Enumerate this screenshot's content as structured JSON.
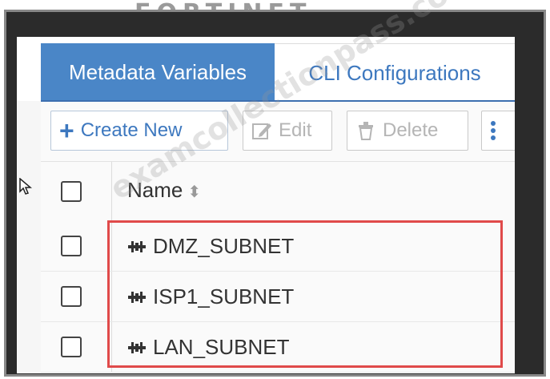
{
  "brand": {
    "logo_text": "FORTINET"
  },
  "tabs": [
    {
      "label": "Metadata Variables",
      "active": true
    },
    {
      "label": "CLI Configurations",
      "active": false
    }
  ],
  "toolbar": {
    "create_label": "Create New",
    "edit_label": "Edit",
    "delete_label": "Delete"
  },
  "table": {
    "header_name": "Name",
    "rows": [
      {
        "name": "DMZ_SUBNET",
        "icon": "network-object-icon"
      },
      {
        "name": "ISP1_SUBNET",
        "icon": "network-object-icon"
      },
      {
        "name": "LAN_SUBNET",
        "icon": "network-object-icon"
      }
    ]
  },
  "watermark": {
    "text": "examcollectionpass.com"
  },
  "colors": {
    "accent": "#4a86c7",
    "highlight": "#e04a4a",
    "text_link": "#3d78bf"
  }
}
